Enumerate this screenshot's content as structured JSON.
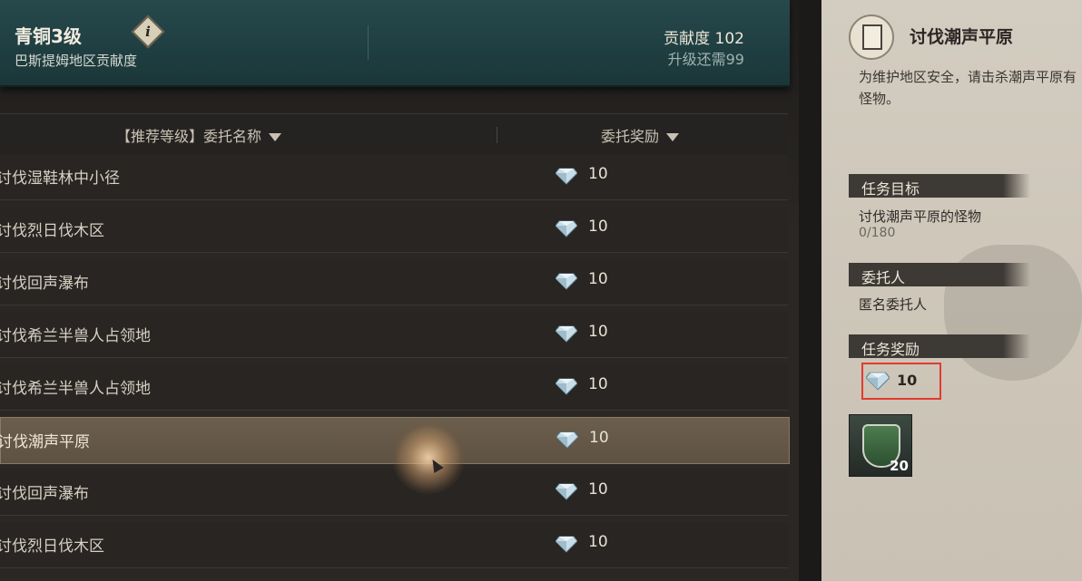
{
  "header": {
    "rank": "青铜3级",
    "region": "巴斯提姆地区贡献度",
    "info_glyph": "i",
    "contribution": "贡献度 102",
    "upgrade": "升级还需99"
  },
  "columns": {
    "name": "【推荐等级】委托名称",
    "reward": "委托奖励"
  },
  "rows": [
    {
      "name": "讨伐湿鞋林中小径",
      "reward": "10"
    },
    {
      "name": "讨伐烈日伐木区",
      "reward": "10"
    },
    {
      "name": "讨伐回声瀑布",
      "reward": "10"
    },
    {
      "name": "讨伐希兰半兽人占领地",
      "reward": "10"
    },
    {
      "name": "讨伐希兰半兽人占领地",
      "reward": "10"
    },
    {
      "name": "讨伐潮声平原",
      "reward": "10"
    },
    {
      "name": "讨伐回声瀑布",
      "reward": "10"
    },
    {
      "name": "讨伐烈日伐木区",
      "reward": "10"
    }
  ],
  "selected_row": 5,
  "detail": {
    "title": "讨伐潮声平原",
    "description": "为维护地区安全，请击杀潮声平原有怪物。",
    "objective_label": "任务目标",
    "objective": "讨伐潮声平原的怪物",
    "progress": "0/180",
    "client_label": "委托人",
    "client": "匿名委托人",
    "reward_label": "任务奖励",
    "reward_value": "10",
    "item_count": "20"
  },
  "colors": {
    "header_teal": "#1f3e41",
    "selected_row": "#6b5e4d",
    "panel_parchment": "#cdc6b9",
    "highlight_red": "#e23a30"
  }
}
